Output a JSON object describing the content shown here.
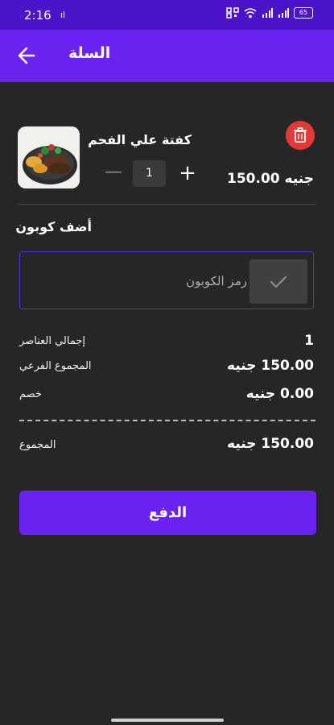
{
  "status_bar": {
    "time": "2:16",
    "left_icon": "ıl",
    "battery": "65",
    "right_icons": [
      "qr-icon",
      "wifi-icon",
      "signal-icon",
      "signal-icon"
    ]
  },
  "app_bar": {
    "title": "السلة",
    "back_icon": "arrow-left-icon"
  },
  "cart_item": {
    "name": "كفتة علي الفحم",
    "quantity": "1",
    "minus_label": "—",
    "plus_label": "+",
    "price": "150.00 جنيه",
    "delete_icon": "trash-icon"
  },
  "coupon": {
    "title": "أضف كوبون",
    "placeholder": "رمز الكوبون",
    "value": "",
    "apply_icon": "check-icon"
  },
  "summary": {
    "items_total_label": "إجمالي العناصر",
    "items_total_value": "1",
    "subtotal_label": "المجموع الفرعي",
    "subtotal_value": "150.00 جنيه",
    "discount_label": "خصم",
    "discount_value": "0.00 جنيه",
    "total_label": "المجموع",
    "total_value": "150.00 جنيه"
  },
  "pay_button": {
    "label": "الدفع"
  },
  "colors": {
    "accent": "#6a22f1",
    "status_bar": "#4b14c9",
    "delete": "#e53935",
    "background": "#262626"
  }
}
